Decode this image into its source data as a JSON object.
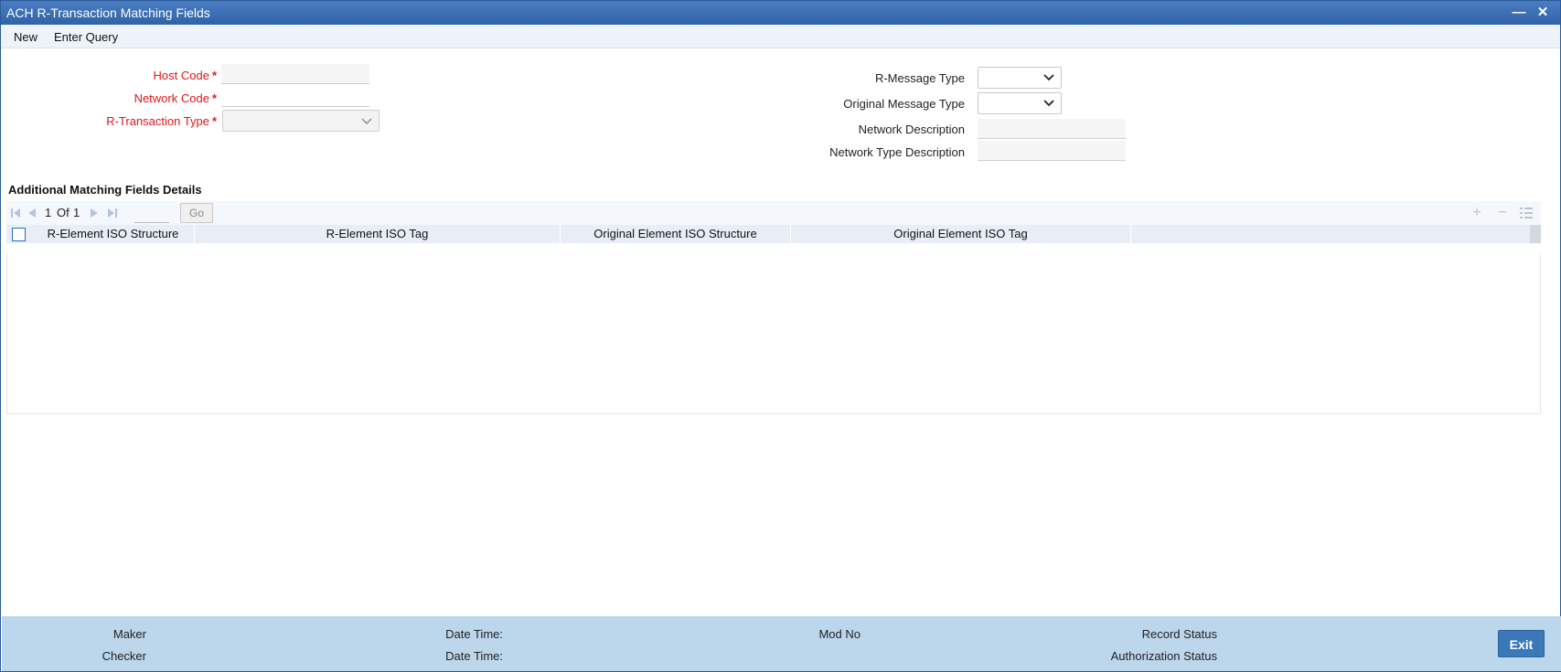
{
  "window": {
    "title": "ACH R-Transaction Matching Fields"
  },
  "menu": {
    "new": "New",
    "enter_query": "Enter Query"
  },
  "form": {
    "host_code": {
      "label": "Host Code",
      "value": ""
    },
    "network_code": {
      "label": "Network Code",
      "value": ""
    },
    "r_transaction_type": {
      "label": "R-Transaction Type",
      "value": ""
    },
    "r_message_type": {
      "label": "R-Message Type",
      "value": ""
    },
    "original_message_type": {
      "label": "Original Message Type",
      "value": ""
    },
    "network_description": {
      "label": "Network Description",
      "value": ""
    },
    "network_type_description": {
      "label": "Network Type Description",
      "value": ""
    },
    "required_mark": "*"
  },
  "section": {
    "title": "Additional Matching Fields Details"
  },
  "pager": {
    "current": "1",
    "of_label": "Of",
    "total": "1",
    "go_label": "Go"
  },
  "grid": {
    "columns": [
      "R-Element ISO Structure",
      "R-Element ISO Tag",
      "Original Element ISO Structure",
      "Original Element ISO Tag"
    ],
    "rows": []
  },
  "footer": {
    "maker": "Maker",
    "checker": "Checker",
    "date_time_1": "Date Time:",
    "date_time_2": "Date Time:",
    "mod_no": "Mod No",
    "record_status": "Record Status",
    "authorization_status": "Authorization Status",
    "exit": "Exit"
  },
  "colors": {
    "title_bar": "#2f63a8",
    "required": "#e0161b",
    "footer": "#bcd6ec",
    "exit_button": "#3a78b8"
  }
}
